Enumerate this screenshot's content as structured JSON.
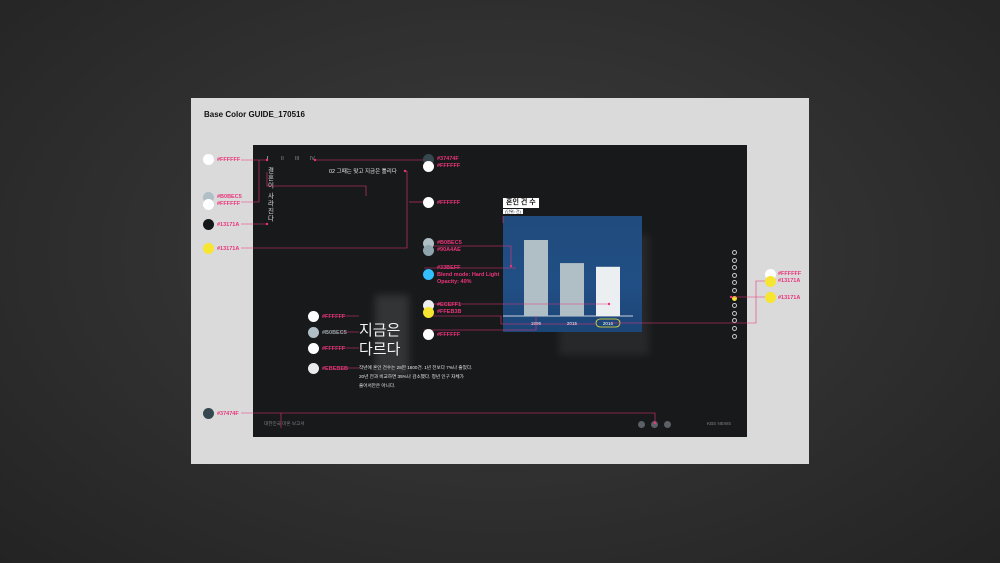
{
  "card_title": "Base Color GUIDE_170516",
  "colors": {
    "pink": "#e9357a",
    "white": "#ffffff",
    "light_gray": "#b0bec5",
    "dark": "#13171a",
    "yellow": "#f6e531",
    "blue": "#33bfff",
    "gray_blue": "#37474f"
  },
  "left_labels": {
    "c1": "#FFFFFF",
    "c2a": "#B0BEC5",
    "c2b": "#FFFFFF",
    "c3": "#13171A",
    "c4": "#13171A",
    "c5": "#37474F"
  },
  "mid_labels": {
    "top_a": "#37474F",
    "top_b": "#FFFFFF",
    "title_white": "#FFFFFF",
    "bars_a": "#B0BEC5",
    "bars_b": "#90A4AE",
    "blend_a": "#33BEFF",
    "blend_b": "Blend mode: Hard Light",
    "blend_c": "Opacity: 40%",
    "axis_a": "#ECEFF1",
    "axis_b": "#FFEB3B",
    "axis_white": "#FFFFFF"
  },
  "text_labels": {
    "l1": "#FFFFFF",
    "l2": "#B0BEC5",
    "l3": "#FFFFFF",
    "l4": "#EBEBEB"
  },
  "right_labels": {
    "r1": "#FFFFFF",
    "r2": "#13171A",
    "r3": "#13171A"
  },
  "screen": {
    "nav_ticks": [
      "I",
      "II",
      "III",
      "IV"
    ],
    "vertical_title": "결혼이 사라진다",
    "subtitle": "02 그때는 맞고 지금은 틀리다",
    "big_line1": "지금은",
    "big_line2": "다르다",
    "paragraph": [
      "작년에 혼인 건수는 28만 1600건. 1년 전보다 7%나 줄었다.",
      "20년 전과 비교하면 35%나 감소했다. 청년 인구 자체가",
      "줄어서만은 아니다."
    ],
    "footer_left": "대한민국 미혼 보고서",
    "footer_right": "KBS NEWS"
  },
  "chart_data": {
    "type": "bar",
    "title": "혼인 건 수",
    "unit_label": "(단위: 건)",
    "categories": [
      "1996",
      "2015",
      "2016"
    ],
    "values": [
      434900,
      302800,
      281600
    ],
    "highlight": "2016"
  }
}
